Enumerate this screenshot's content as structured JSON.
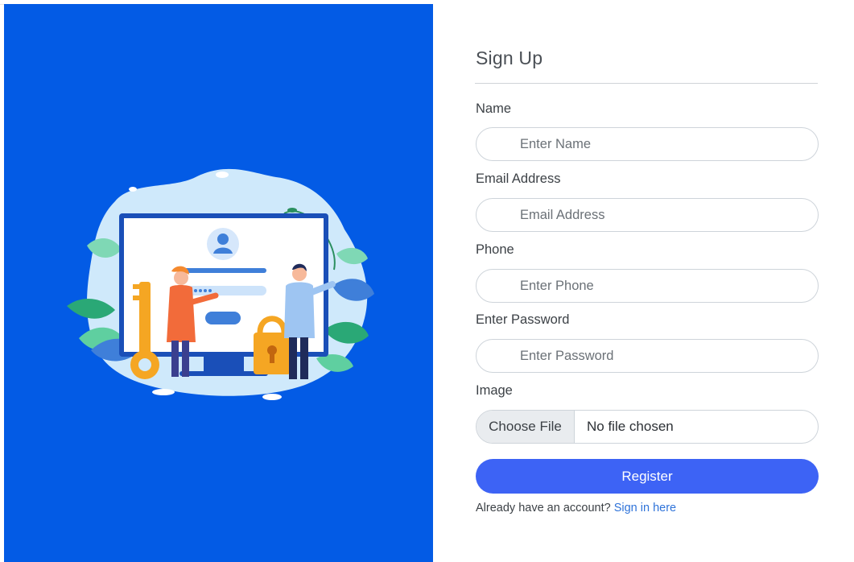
{
  "form": {
    "title": "Sign Up",
    "fields": [
      {
        "label": "Name",
        "placeholder": "Enter Name",
        "value": ""
      },
      {
        "label": "Email Address",
        "placeholder": "Email Address",
        "value": ""
      },
      {
        "label": "Phone",
        "placeholder": "Enter Phone",
        "value": ""
      },
      {
        "label": "Enter Password",
        "placeholder": "Enter Password",
        "value": ""
      }
    ],
    "image": {
      "label": "Image",
      "choose_label": "Choose File",
      "status": "No file chosen"
    },
    "register_label": "Register",
    "signin_prompt": "Already have an account?",
    "signin_link": "Sign in here"
  },
  "theme": {
    "panel_color": "#035be5",
    "button_color": "#3d63f5",
    "link_color": "#2f73d9"
  },
  "illustration": {
    "icon": "secure-login-illustration"
  }
}
